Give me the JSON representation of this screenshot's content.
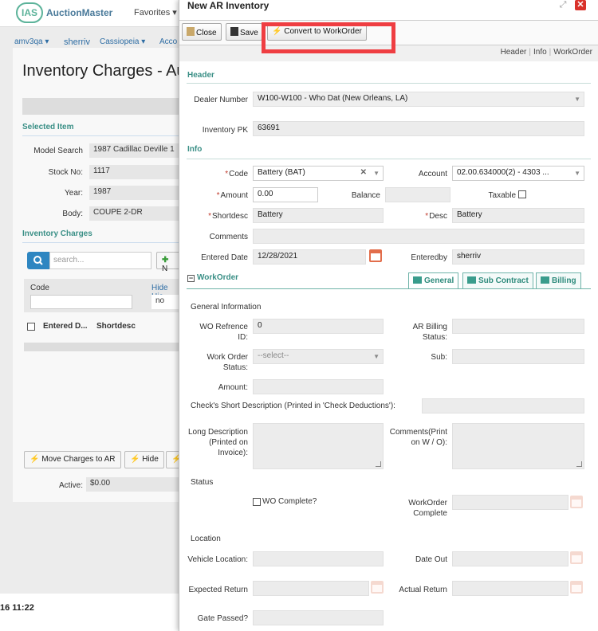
{
  "background": {
    "logo_badge": "IAS",
    "logo_text": "AuctionMaster",
    "favorites": "Favorites ▾",
    "subnav": [
      "amv3qa ▾",
      "sherriv",
      "Cassiopeia ▾",
      "Acco"
    ],
    "page_title": "Inventory Charges - Au",
    "selected_item": "Selected Item",
    "fields": [
      {
        "label": "Model Search",
        "value": "1987 Cadillac Deville 1"
      },
      {
        "label": "Stock No:",
        "value": "1117"
      },
      {
        "label": "Year:",
        "value": "1987"
      },
      {
        "label": "Body:",
        "value": "COUPE 2-DR"
      }
    ],
    "inventory_charges": "Inventory Charges",
    "search_placeholder": "search...",
    "new_btn": "N",
    "grid_code_label": "Code",
    "grid_hide": "Hide Hic",
    "grid_no": "no",
    "grid_cols": [
      "Entered D...",
      "Shortdesc"
    ],
    "move_btn": "Move Charges to AR",
    "hide_btn": "Hide",
    "active_label": "Active:",
    "active_value": "$0.00",
    "clock": "16 11:22"
  },
  "dialog": {
    "title": "New AR Inventory",
    "toolbar": {
      "close": "Close",
      "save": "Save",
      "convert": "Convert to WorkOrder"
    },
    "crumbs": [
      "Header",
      "Info",
      "WorkOrder"
    ],
    "header_section": "Header",
    "dealer_number_label": "Dealer Number",
    "dealer_number": "W100-W100 - Who Dat (New Orleans, LA)",
    "inventory_pk_label": "Inventory PK",
    "inventory_pk": "63691",
    "info_section": "Info",
    "code_label": "Code",
    "code": "Battery (BAT)",
    "account_label": "Account",
    "account": "02.00.634000(2) - 4303 ...",
    "amount_label": "Amount",
    "amount": "0.00",
    "balance_label": "Balance",
    "taxable_label": "Taxable",
    "shortdesc_label": "Shortdesc",
    "shortdesc": "Battery",
    "desc_label": "Desc",
    "desc": "Battery",
    "comments_label": "Comments",
    "entered_date_label": "Entered Date",
    "entered_date": "12/28/2021",
    "enteredby_label": "Enteredby",
    "enteredby": "sherriv",
    "workorder_section": "WorkOrder",
    "tabs": [
      "General",
      "Sub Contract",
      "Billing"
    ],
    "general_info": "General Information",
    "wo_ref_label": "WO Refrence ID:",
    "wo_ref": "0",
    "ar_billing_label": "AR Billing Status:",
    "wo_status_label": "Work Order Status:",
    "wo_status": "--select--",
    "sub_label": "Sub:",
    "amount2_label": "Amount:",
    "check_short_label": "Check's Short Description (Printed in 'Check Deductions'):",
    "long_desc_label": "Long Description (Printed on Invoice):",
    "comments_print_label": "Comments(Print on W / O):",
    "status_section": "Status",
    "wo_complete_chk": "WO Complete?",
    "wo_complete_label": "WorkOrder Complete",
    "location_section": "Location",
    "vehicle_location_label": "Vehicle Location:",
    "date_out_label": "Date Out",
    "expected_return_label": "Expected Return",
    "actual_return_label": "Actual Return",
    "gate_passed_label": "Gate Passed?"
  },
  "colors": {
    "accent": "#3a8f86",
    "highlight": "#ef3e42",
    "link": "#2e6da4"
  }
}
